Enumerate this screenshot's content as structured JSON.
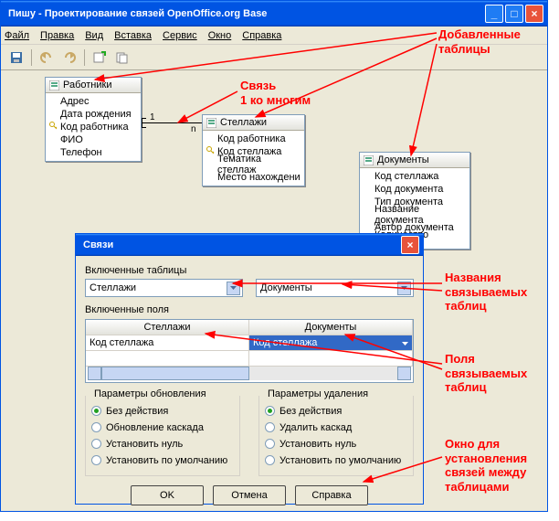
{
  "main": {
    "title": "Пишу - Проектирование связей OpenOffice.org Base",
    "menu": {
      "file": "Файл",
      "edit": "Правка",
      "view": "Вид",
      "insert": "Вставка",
      "tools": "Сервис",
      "window": "Окно",
      "help": "Справка"
    }
  },
  "tables": {
    "workers": {
      "title": "Работники",
      "fields": [
        "Адрес",
        "Дата рождения",
        "Код работника",
        "ФИО",
        "Телефон"
      ],
      "key_idx": 2
    },
    "racks": {
      "title": "Стеллажи",
      "fields": [
        "Код работника",
        "Код стеллажа",
        "Тематика стеллаж",
        "Место нахождени"
      ],
      "key_idx": 1
    },
    "docs": {
      "title": "Документы",
      "fields": [
        "Код стеллажа",
        "Код документа",
        "Тип документа",
        "Название документа",
        "Автор документа",
        "Количество экземпл"
      ]
    }
  },
  "dlg": {
    "title": "Связи",
    "inc_tables": "Включенные таблицы",
    "combo1": "Стеллажи",
    "combo2": "Документы",
    "inc_fields": "Включенные поля",
    "hdr1": "Стеллажи",
    "hdr2": "Документы",
    "cell1": "Код стеллажа",
    "cell2": "Код стеллажа",
    "update_legend": "Параметры обновления",
    "delete_legend": "Параметры удаления",
    "radios": {
      "none_u": "Без действия",
      "casc_u": "Обновление каскада",
      "null_u": "Установить нуль",
      "def_u": "Установить по умолчанию",
      "none_d": "Без действия",
      "casc_d": "Удалить каскад",
      "null_d": "Установить нуль",
      "def_d": "Установить по умолчанию"
    },
    "buttons": {
      "ok": "OK",
      "cancel": "Отмена",
      "help": "Справка"
    }
  },
  "annots": {
    "added": "Добавленные\nтаблицы",
    "rel": "Связь\n1 ко многим",
    "names": "Названия\nсвязываемых\nтаблиц",
    "fields": "Поля\nсвязываемых\nтаблиц",
    "window": "Окно для\nустановления\nсвязей между\nтаблицами"
  }
}
